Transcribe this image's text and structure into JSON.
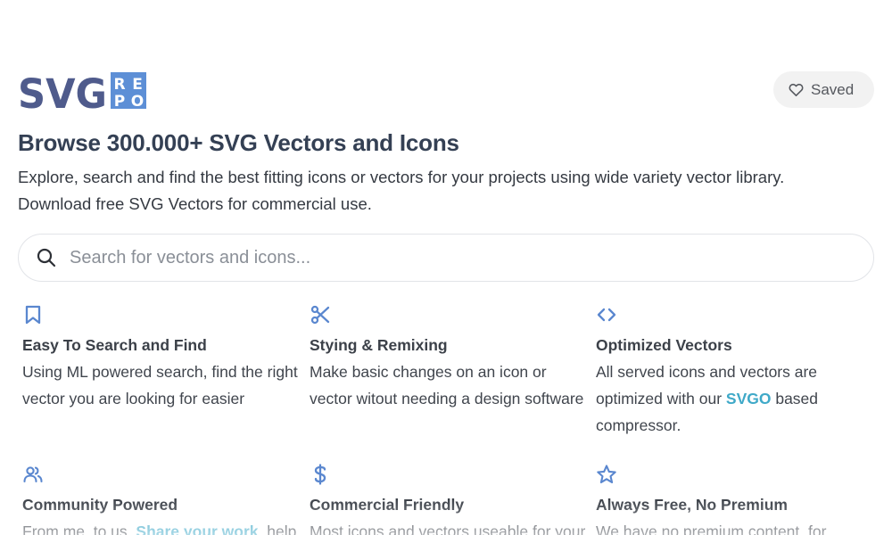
{
  "brand": {
    "logo_text": "SVG",
    "logo_badge": [
      "R",
      "E",
      "P",
      "O"
    ]
  },
  "header": {
    "saved_label": "Saved"
  },
  "hero": {
    "title": "Browse 300.000+ SVG Vectors and Icons",
    "description_line1": "Explore, search and find the best fitting icons or vectors for your projects using wide variety vector library.",
    "description_line2": "Download free SVG Vectors for commercial use."
  },
  "search": {
    "placeholder": "Search for vectors and icons..."
  },
  "features": [
    {
      "icon": "bookmark-icon",
      "title": "Easy To Search and Find",
      "description": "Using ML powered search, find the right vector you are looking for easier"
    },
    {
      "icon": "scissors-icon",
      "title": "Stying & Remixing",
      "description": "Make basic changes on an icon or vector witout needing a design software"
    },
    {
      "icon": "code-icon",
      "title": "Optimized Vectors",
      "description_before": "All served icons and vectors are optimized with our ",
      "link": "SVGO",
      "description_after": " based compressor."
    },
    {
      "icon": "users-icon",
      "title": "Community Powered",
      "description_before": "From me, to us. ",
      "link": "Share your work",
      "description_after": ", help"
    },
    {
      "icon": "dollar-icon",
      "title": "Commercial Friendly",
      "description": "Most icons and vectors useable for your"
    },
    {
      "icon": "star-icon",
      "title": "Always Free, No Premium",
      "description": "We have no premium content, for"
    }
  ],
  "colors": {
    "logo_text": "#4f5b8c",
    "logo_badge": "#5d8fd6",
    "icon_accent": "#5a87cf",
    "link": "#3fa9c8"
  }
}
